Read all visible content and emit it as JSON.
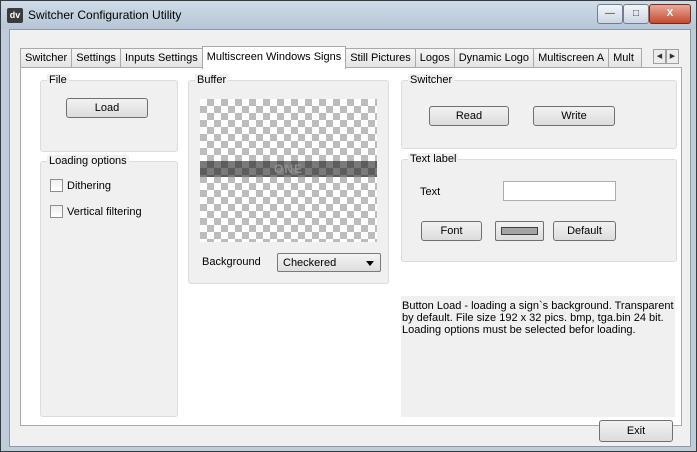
{
  "window": {
    "title": "Switcher Configuration Utility",
    "app_icon": "dv",
    "controls": {
      "minimize": "—",
      "maximize": "□",
      "close": "X"
    }
  },
  "tabs": [
    {
      "label": "Switcher",
      "active": false
    },
    {
      "label": "Settings",
      "active": false
    },
    {
      "label": "Inputs Settings",
      "active": false
    },
    {
      "label": "Multiscreen Windows Signs",
      "active": true
    },
    {
      "label": "Still Pictures",
      "active": false
    },
    {
      "label": "Logos",
      "active": false
    },
    {
      "label": "Dynamic Logo",
      "active": false
    },
    {
      "label": "Multiscreen A",
      "active": false
    },
    {
      "label": "Mult",
      "active": false
    }
  ],
  "tab_scroll": {
    "left": "◀",
    "right": "▶"
  },
  "file_group": {
    "label": "File",
    "load_button": "Load"
  },
  "loading_options": {
    "label": "Loading options",
    "dithering": {
      "label": "Dithering",
      "checked": false
    },
    "vertical_filtering": {
      "label": "Vertical filtering",
      "checked": false
    }
  },
  "buffer": {
    "label": "Buffer",
    "preview_text": "ONE",
    "background_label": "Background",
    "background_value": "Checkered"
  },
  "switcher_group": {
    "label": "Switcher",
    "read_button": "Read",
    "write_button": "Write"
  },
  "text_label_group": {
    "label": "Text label",
    "text_label": "Text",
    "text_value": "",
    "font_button": "Font",
    "color_swatch": "#a4a4a4",
    "default_button": "Default"
  },
  "help_text": "Button Load - loading a sign`s background. Transparent by default. File size 192 x 32 pics. bmp, tga.bin 24 bit. Loading options must be  selected befor loading.",
  "exit_button": "Exit"
}
